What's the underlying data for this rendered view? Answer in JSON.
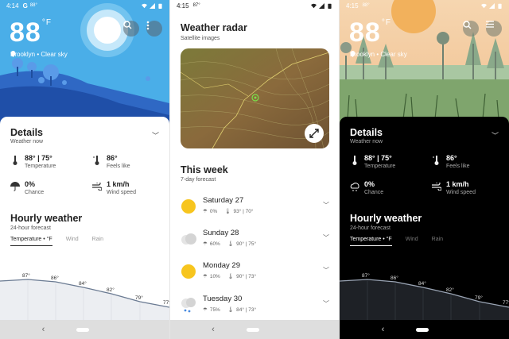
{
  "screens": {
    "light": {
      "status": {
        "time": "4:14",
        "temp": "88°"
      },
      "hero": {
        "temp": "88",
        "unit": "°F",
        "location": "Brooklyn • Clear sky"
      },
      "details": {
        "title": "Details",
        "subtitle": "Weather now"
      },
      "metrics": [
        {
          "value": "88° | 75°",
          "label": "Temperature",
          "icon": "thermometer-icon"
        },
        {
          "value": "86°",
          "label": "Feels like",
          "icon": "feels-like-icon"
        },
        {
          "value": "0%",
          "label": "Chance",
          "icon": "umbrella-icon"
        },
        {
          "value": "1 km/h",
          "label": "Wind speed",
          "icon": "wind-icon"
        }
      ],
      "hourly": {
        "title": "Hourly weather",
        "subtitle": "24-hour forecast"
      },
      "tabs": [
        "Temperature • °F",
        "Wind",
        "Rain"
      ],
      "hourly_temps": [
        "87°",
        "86°",
        "84°",
        "82°",
        "79°",
        "77°"
      ]
    },
    "radar": {
      "status": {
        "time": "4:15",
        "temp": "87°"
      },
      "title": "Weather radar",
      "subtitle": "Satellite images",
      "week_title": "This week",
      "week_subtitle": "7-day forecast",
      "days": [
        {
          "name": "Saturday 27",
          "rain": "0%",
          "temps": "93° | 70°",
          "icon": "sun-icon"
        },
        {
          "name": "Sunday 28",
          "rain": "60%",
          "temps": "90° | 75°",
          "icon": "cloud-icon"
        },
        {
          "name": "Monday 29",
          "rain": "10%",
          "temps": "90° | 73°",
          "icon": "sun-icon"
        },
        {
          "name": "Tuesday 30",
          "rain": "75%",
          "temps": "84° | 73°",
          "icon": "rain-cloud-icon"
        }
      ]
    },
    "dark": {
      "status": {
        "time": "4:15",
        "temp": "88°"
      },
      "hero": {
        "temp": "88",
        "unit": "°F",
        "location": "Brooklyn • Clear sky"
      },
      "details": {
        "title": "Details",
        "subtitle": "Weather now"
      },
      "metrics": [
        {
          "value": "88° | 75°",
          "label": "Temperature",
          "icon": "thermometer-icon"
        },
        {
          "value": "86°",
          "label": "Feels like",
          "icon": "feels-like-icon"
        },
        {
          "value": "0%",
          "label": "Chance",
          "icon": "cloud-rain-icon"
        },
        {
          "value": "1 km/h",
          "label": "Wind speed",
          "icon": "wind-icon"
        }
      ],
      "hourly": {
        "title": "Hourly weather",
        "subtitle": "24-hour forecast"
      },
      "tabs": [
        "Temperature • °F",
        "Wind",
        "Rain"
      ],
      "hourly_temps": [
        "87°",
        "86°",
        "84°",
        "82°",
        "79°",
        "77°"
      ]
    }
  },
  "colors": {
    "sky_light": "#4aaee8",
    "sky_dark_scene": "#f4c9a0",
    "sun": "#f2b15c",
    "hill_blue": "#2f68c4",
    "chart_line": "#6a7a92"
  }
}
